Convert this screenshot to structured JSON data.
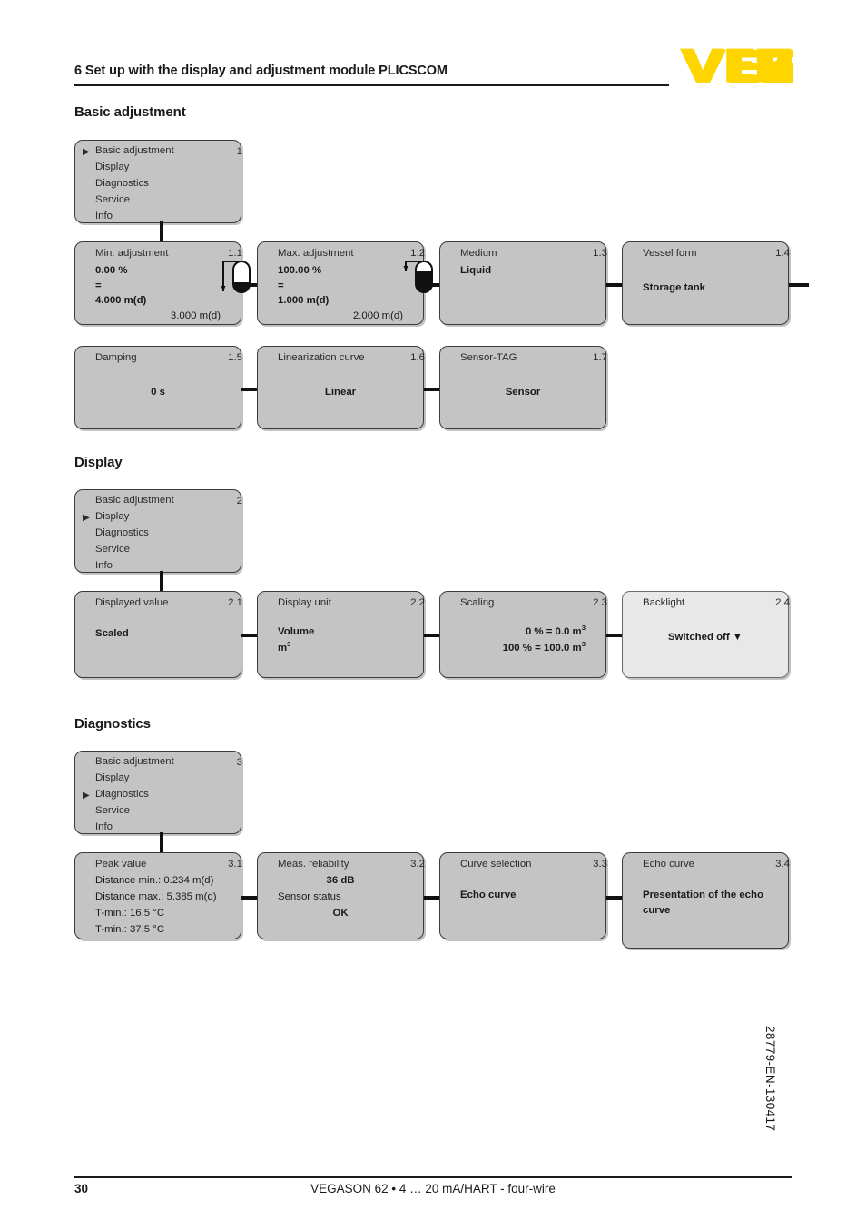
{
  "header": {
    "title": "6 Set up with the display and adjustment module PLICSCOM",
    "logo_text": "VEGA",
    "logo_color": "#FFD500"
  },
  "sections": [
    {
      "heading": "Basic adjustment"
    },
    {
      "heading": "Display"
    },
    {
      "heading": "Diagnostics"
    }
  ],
  "menus": {
    "basic": {
      "number": "1",
      "items": [
        {
          "label": "Basic adjustment",
          "selected": true
        },
        {
          "label": "Display",
          "selected": false
        },
        {
          "label": "Diagnostics",
          "selected": false
        },
        {
          "label": "Service",
          "selected": false
        },
        {
          "label": "Info",
          "selected": false
        }
      ]
    },
    "display": {
      "number": "2",
      "items": [
        {
          "label": "Basic adjustment",
          "selected": false
        },
        {
          "label": "Display",
          "selected": true
        },
        {
          "label": "Diagnostics",
          "selected": false
        },
        {
          "label": "Service",
          "selected": false
        },
        {
          "label": "Info",
          "selected": false
        }
      ]
    },
    "diagnostics": {
      "number": "3",
      "items": [
        {
          "label": "Basic adjustment",
          "selected": false
        },
        {
          "label": "Display",
          "selected": false
        },
        {
          "label": "Diagnostics",
          "selected": true
        },
        {
          "label": "Service",
          "selected": false
        },
        {
          "label": "Info",
          "selected": false
        }
      ]
    }
  },
  "marker_glyph": "▶",
  "boxes": {
    "b11": {
      "title": "Min. adjustment",
      "number": "1.1",
      "l1": "0.00 %",
      "l2": "=",
      "l3": "4.000 m(d)",
      "l4": "3.000 m(d)"
    },
    "b12": {
      "title": "Max. adjustment",
      "number": "1.2",
      "l1": "100.00 %",
      "l2": "=",
      "l3": "1.000 m(d)",
      "l4": "2.000 m(d)"
    },
    "b13": {
      "title": "Medium",
      "number": "1.3",
      "value": "Liquid"
    },
    "b14": {
      "title": "Vessel form",
      "number": "1.4",
      "value": "Storage tank"
    },
    "b15": {
      "title": "Damping",
      "number": "1.5",
      "value": "0 s"
    },
    "b16": {
      "title": "Linearization curve",
      "number": "1.6",
      "value": "Linear"
    },
    "b17": {
      "title": "Sensor-TAG",
      "number": "1.7",
      "value": "Sensor"
    },
    "b21": {
      "title": "Displayed value",
      "number": "2.1",
      "value": "Scaled"
    },
    "b22": {
      "title": "Display unit",
      "number": "2.2",
      "l1": "Volume",
      "l2_pre": "m",
      "l2_sup": "3"
    },
    "b23": {
      "title": "Scaling",
      "number": "2.3",
      "l1_pre": "0 % = 0.0 m",
      "l1_sup": "3",
      "l2_pre": "100 % = 100.0 m",
      "l2_sup": "3"
    },
    "b24": {
      "title": "Backlight",
      "number": "2.4",
      "value": "Switched off ▼"
    },
    "b31": {
      "title": "Peak value",
      "number": "3.1",
      "l1": "Distance min.: 0.234 m(d)",
      "l2": "Distance max.: 5.385 m(d)",
      "l3": "T-min.: 16.5 °C",
      "l4": "T-min.: 37.5 °C"
    },
    "b32": {
      "title": "Meas. reliability",
      "number": "3.2",
      "l1": "36 dB",
      "l2": "Sensor status",
      "l3": "OK"
    },
    "b33": {
      "title": "Curve selection",
      "number": "3.3",
      "value": "Echo curve"
    },
    "b34": {
      "title": "Echo curve",
      "number": "3.4",
      "l1": "Presentation of the echo",
      "l2": "curve"
    }
  },
  "footer": {
    "page_number": "30",
    "document_line": "VEGASON 62 • 4 … 20 mA/HART - four-wire",
    "doc_number": "28779-EN-130417"
  }
}
